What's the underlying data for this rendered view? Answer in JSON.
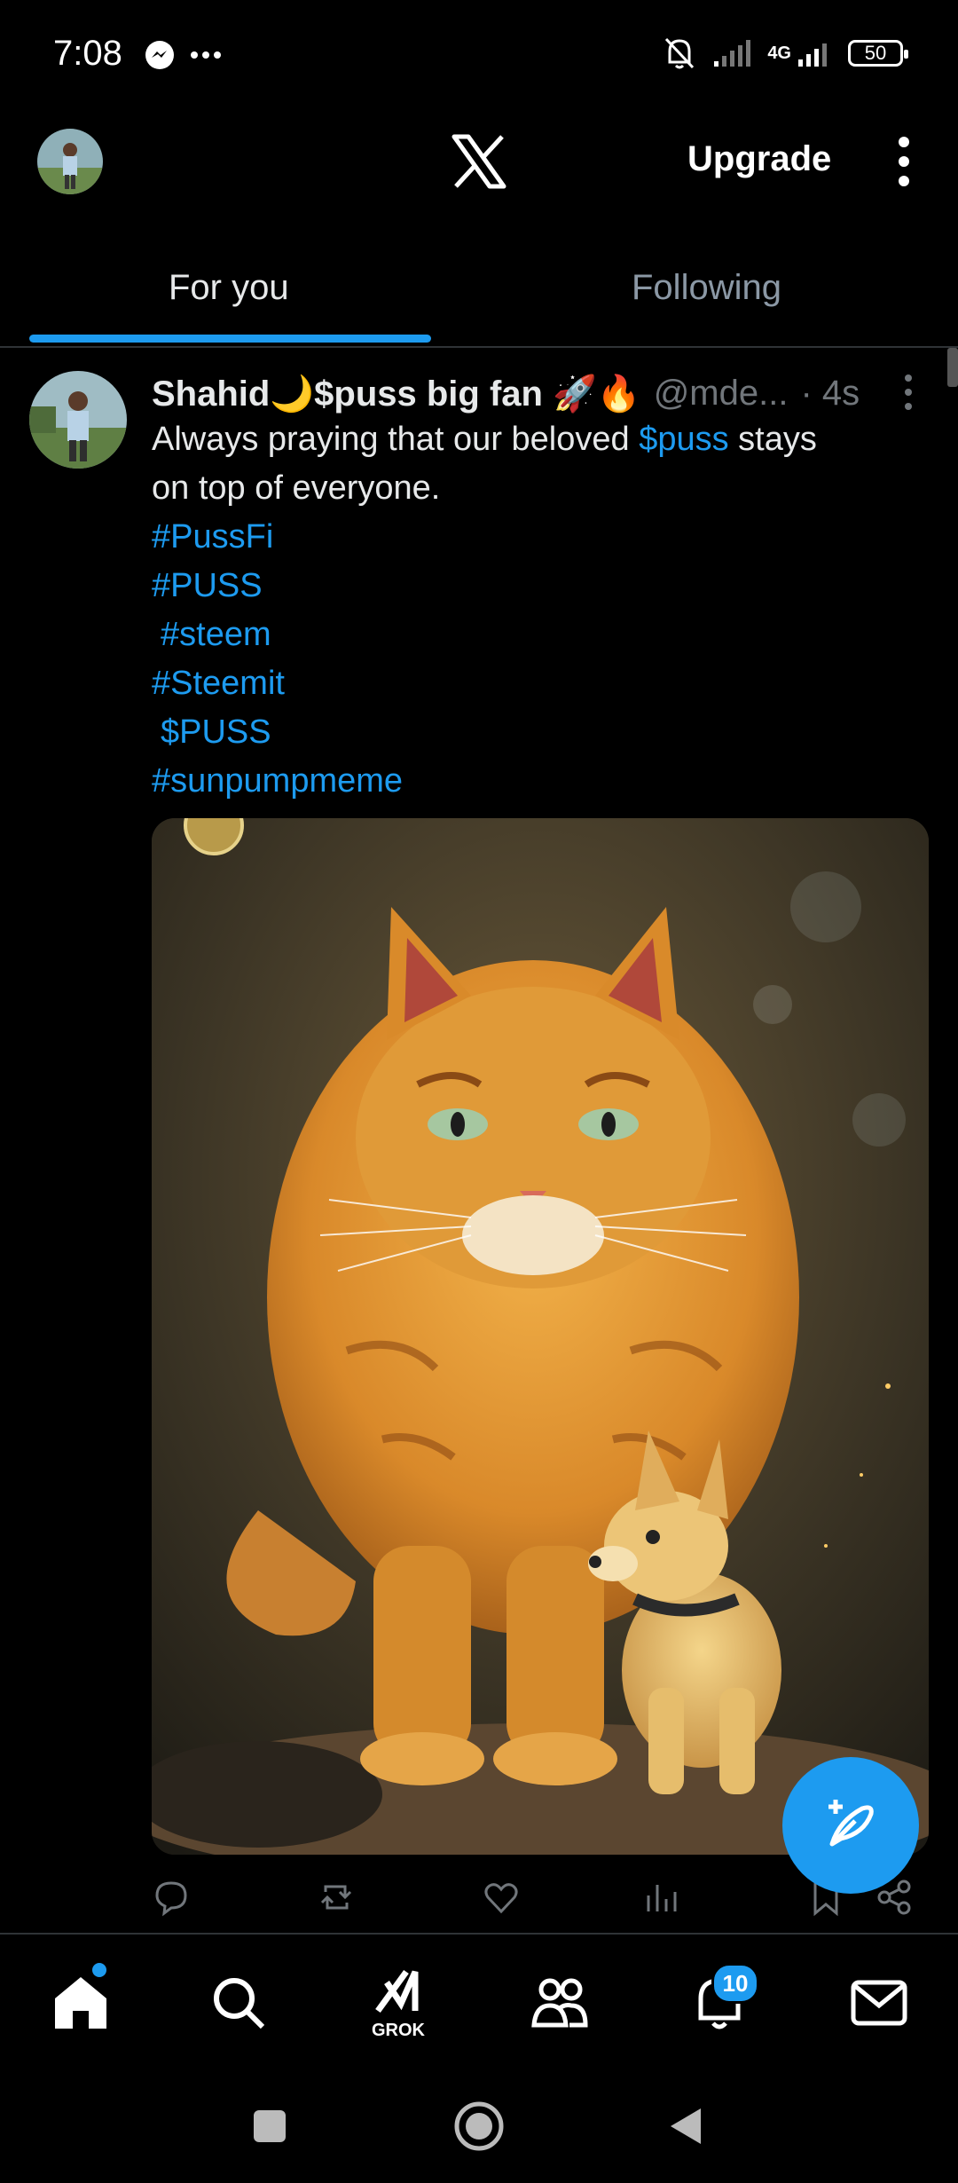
{
  "status_bar": {
    "time": "7:08",
    "network": "4G",
    "battery": "50"
  },
  "top_bar": {
    "upgrade_label": "Upgrade"
  },
  "tabs": [
    {
      "label": "For you",
      "active": true
    },
    {
      "label": "Following",
      "active": false
    }
  ],
  "post": {
    "author": "Shahid🌙$puss big fan 🚀🔥",
    "handle": "@mde...",
    "time": "· 4s",
    "text_lines": [
      {
        "pre": "Always praying that our beloved ",
        "link": "$puss",
        "post": " stays"
      },
      {
        "pre": "on top of everyone.",
        "link": "",
        "post": ""
      },
      {
        "pre": "",
        "link": "#PussFi",
        "post": ""
      },
      {
        "pre": "",
        "link": "#PUSS",
        "post": ""
      },
      {
        "pre": " ",
        "link": "#steem",
        "post": ""
      },
      {
        "pre": "",
        "link": "#Steemit",
        "post": ""
      },
      {
        "pre": " ",
        "link": "$PUSS",
        "post": ""
      },
      {
        "pre": "",
        "link": "#sunpumpmeme",
        "post": ""
      }
    ]
  },
  "bottom_nav": {
    "grok_label": "GROK",
    "notifications_badge": "10"
  },
  "colors": {
    "accent": "#1d9bf0",
    "background": "#000000",
    "muted": "#71767b"
  }
}
